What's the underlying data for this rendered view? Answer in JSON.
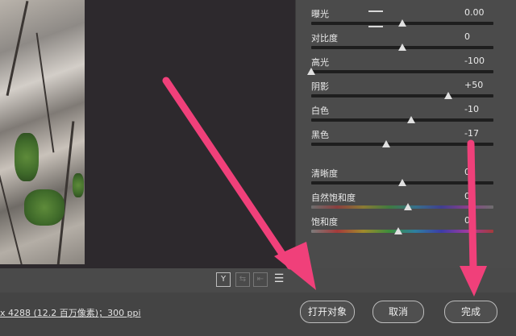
{
  "panel": {
    "sliders": [
      {
        "label": "曝光",
        "value": "0.00",
        "level": 0.5
      },
      {
        "label": "对比度",
        "value": "0",
        "level": 0.5
      },
      {
        "label": "高光",
        "value": "-100",
        "level": 0.0
      },
      {
        "label": "阴影",
        "value": "+50",
        "level": 0.75
      },
      {
        "label": "白色",
        "value": "-10",
        "level": 0.55
      },
      {
        "label": "黑色",
        "value": "-17",
        "level": 0.41
      },
      {
        "label": "清晰度",
        "value": "0",
        "level": 0.5
      },
      {
        "label": "自然饱和度",
        "value": "0",
        "level": 0.53
      },
      {
        "label": "饱和度",
        "value": "0",
        "level": 0.48
      }
    ]
  },
  "toolbar": {
    "icons": [
      {
        "name": "y-compare-icon",
        "glyph": "Y"
      },
      {
        "name": "swap-icon",
        "glyph": "⇆"
      },
      {
        "name": "copy-settings-icon",
        "glyph": "⇤"
      },
      {
        "name": "sliders-settings-icon",
        "glyph": "☰"
      }
    ]
  },
  "footer": {
    "file_info": "x 4288 (12.2 百万像素)；300 ppi",
    "open_object_label": "打开对象",
    "cancel_label": "取消",
    "done_label": "完成"
  },
  "colors": {
    "annotation_arrow": "#f0407a",
    "panel_bg": "#4b4b4b",
    "canvas_bg": "#2d292d"
  }
}
